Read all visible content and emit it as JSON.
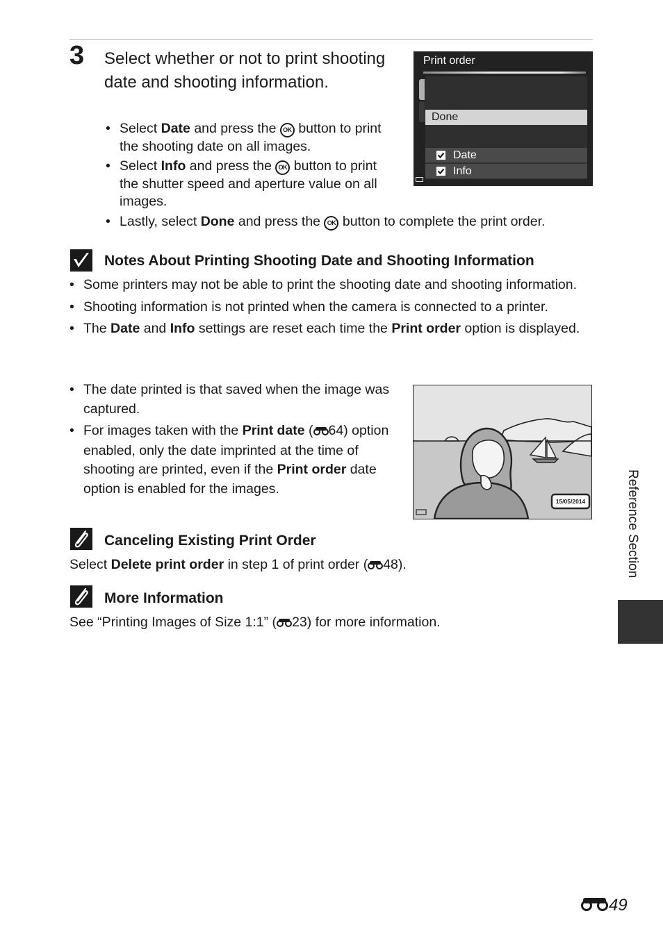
{
  "step": {
    "number": "3",
    "title": "Select whether or not to print shooting date and shooting information.",
    "bullets": [
      {
        "pre": "Select ",
        "bold": "Date",
        "mid": " and press the ",
        "ok": "OK",
        "post": " button to print the shooting date on all images."
      },
      {
        "pre": "Select ",
        "bold": "Info",
        "mid": " and press the ",
        "ok": "OK",
        "post": " button to print the shutter speed and aperture value on all images."
      },
      {
        "pre": "Lastly, select ",
        "bold": "Done",
        "mid": " and press the ",
        "ok": "OK",
        "post": " button to complete the print order."
      }
    ]
  },
  "camera_screen": {
    "title": "Print order",
    "selected_item": "Done",
    "options": [
      {
        "label": "Date",
        "checked": true
      },
      {
        "label": "Info",
        "checked": true
      }
    ]
  },
  "notes": {
    "heading": "Notes About Printing Shooting Date and Shooting Information",
    "icon": "checkmark-icon",
    "bullets": [
      {
        "text": "Some printers may not be able to print the shooting date and shooting information."
      },
      {
        "text": "Shooting information is not printed when the camera is connected to a printer."
      },
      {
        "pre": "The ",
        "b1": "Date",
        "m1": " and ",
        "b2": "Info",
        "m2": " settings are reset each time the ",
        "b3": "Print order",
        "post": " option is displayed."
      },
      {
        "text": "The date printed is that saved when the image was captured."
      },
      {
        "pre": "For images taken with the ",
        "b1": "Print date",
        "m1": " (",
        "ref": "64",
        "m2": ") option enabled, only the date imprinted at the time of shooting are printed, even if the ",
        "b2": "Print order",
        "post": " date option is enabled for the images."
      }
    ]
  },
  "photo": {
    "date_stamp": "15/05/2014"
  },
  "canceling": {
    "heading": "Canceling Existing Print Order",
    "icon": "paperclip-icon",
    "pre": "Select ",
    "bold": "Delete print order",
    "mid": " in step 1 of print order (",
    "ref": "48",
    "post": ")."
  },
  "more_info": {
    "heading": "More Information",
    "icon": "paperclip-icon",
    "pre": "See “Printing Images of Size 1:1” (",
    "ref": "23",
    "post": ") for more information."
  },
  "side_tab": {
    "label": "Reference Section"
  },
  "page_number": "49"
}
